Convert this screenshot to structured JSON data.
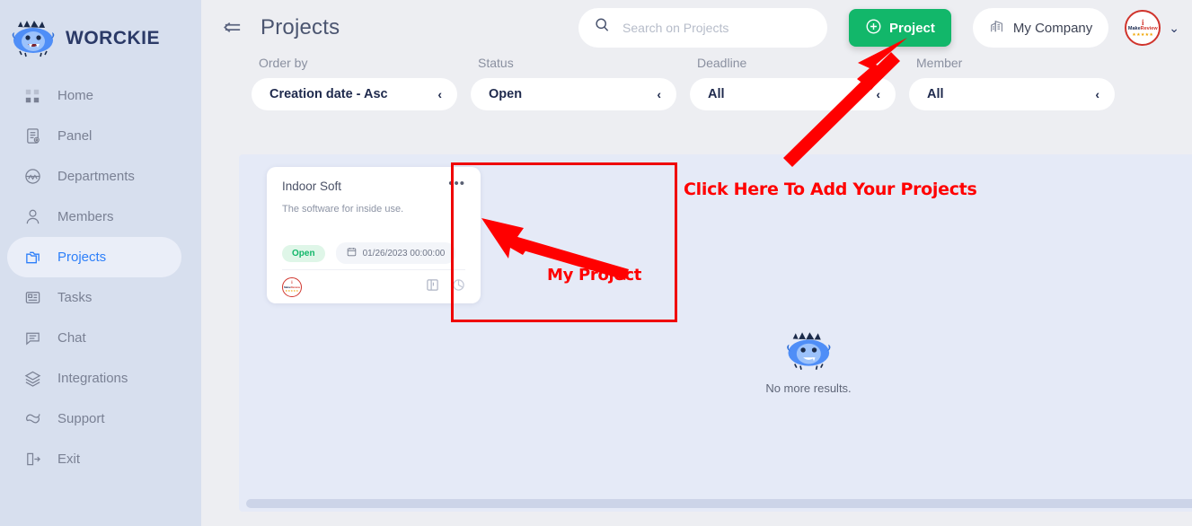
{
  "brand": {
    "name": "WORCKIE",
    "logo_icon": "worckie-mascot-icon"
  },
  "sidebar": {
    "items": [
      {
        "label": "Home",
        "icon": "grid-icon",
        "active": false
      },
      {
        "label": "Panel",
        "icon": "panel-icon",
        "active": false
      },
      {
        "label": "Departments",
        "icon": "departments-icon",
        "active": false
      },
      {
        "label": "Members",
        "icon": "user-icon",
        "active": false
      },
      {
        "label": "Projects",
        "icon": "folder-icon",
        "active": true
      },
      {
        "label": "Tasks",
        "icon": "tasks-icon",
        "active": false
      },
      {
        "label": "Chat",
        "icon": "chat-icon",
        "active": false
      },
      {
        "label": "Integrations",
        "icon": "layers-icon",
        "active": false
      },
      {
        "label": "Support",
        "icon": "support-icon",
        "active": false
      },
      {
        "label": "Exit",
        "icon": "exit-icon",
        "active": false
      }
    ]
  },
  "header": {
    "collapse_icon": "collapse-sidebar-icon",
    "title": "Projects",
    "search": {
      "value": "",
      "placeholder": "Search on Projects",
      "icon": "search-icon"
    },
    "add_project_button": {
      "label": "Project",
      "icon": "plus-circle-icon"
    },
    "company_button": {
      "label": "My Company",
      "icon": "building-icon"
    },
    "avatar": {
      "icon": "make-review-avatar",
      "line_i": "i",
      "line_make": "Make",
      "line_review": "Review",
      "stars": "★★★★★"
    },
    "chevron": "⌄"
  },
  "filters": [
    {
      "label": "Order by",
      "value": "Creation date - Asc",
      "chevron": "‹"
    },
    {
      "label": "Status",
      "value": "Open",
      "chevron": "‹"
    },
    {
      "label": "Deadline",
      "value": "All",
      "chevron": "‹"
    },
    {
      "label": "Member",
      "value": "All",
      "chevron": "‹"
    }
  ],
  "project_card": {
    "title": "Indoor Soft",
    "menu_icon": "more-options-icon",
    "menu_glyph": "•••",
    "description": "The software for inside use.",
    "status": "Open",
    "date": "01/26/2023 00:00:00",
    "date_icon": "calendar-icon",
    "member_avatar": {
      "line_i": "i",
      "line_make": "Make",
      "line_review": "Review",
      "stars": "★★★★★"
    },
    "footer_icons": [
      "board-icon",
      "chart-icon"
    ]
  },
  "empty_state": {
    "icon": "worckie-mascot-icon",
    "text": "No more results."
  },
  "annotations": [
    {
      "id": "add",
      "text": "Click Here To Add Your Projects",
      "color": "#ff0000"
    },
    {
      "id": "myproject",
      "text": "My Project",
      "color": "#ff0000"
    }
  ],
  "colors": {
    "accent_green": "#12b76a",
    "accent_blue": "#2d7ff9",
    "sidebar_bg": "#d7dfee",
    "content_bg": "#e5eaf7",
    "annotation_red": "#ff0000",
    "status_open": "#12b76a"
  }
}
